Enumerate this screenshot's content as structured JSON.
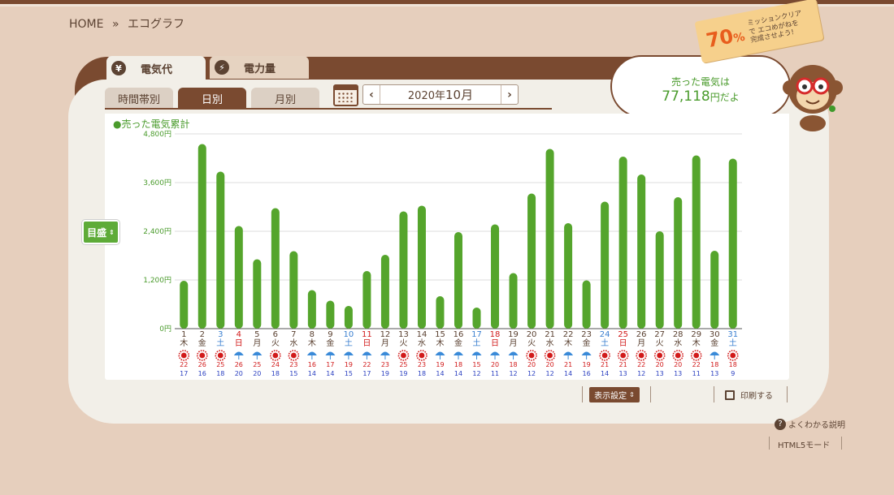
{
  "breadcrumb": {
    "home": "HOME",
    "separator": "»",
    "current": "エコグラフ"
  },
  "tag": {
    "percent": "70",
    "percent_unit": "%",
    "message": "ミッションクリアで エコめがねを 完成させよう!"
  },
  "main_tabs": [
    {
      "icon": "¥",
      "label": "電気代"
    },
    {
      "icon": "⚡",
      "label": "電力量"
    }
  ],
  "sub_tabs": [
    "時間帯別",
    "日別",
    "月別"
  ],
  "date_nav": {
    "year_prefix": "2020年",
    "month": "10月",
    "prev": "‹",
    "next": "›"
  },
  "bubble": {
    "line1": "売った電気は",
    "amount": "77,118",
    "unit": "円だよ"
  },
  "ruler_label": "目盛",
  "controls": {
    "display_settings": "表示設定",
    "print": "印刷する",
    "help": "よくわかる説明",
    "html5": "HTML5モード"
  },
  "colors": {
    "bar": "#55a52c",
    "sunday": "#d11a1a",
    "saturday": "#3a7fd0",
    "weekday": "#5a4030",
    "high": "#d11a1a",
    "low": "#2a3fc0"
  },
  "chart_data": {
    "type": "bar",
    "title": "●売った電気累計",
    "xlabel": "",
    "ylabel": "",
    "ylim": [
      0,
      4800
    ],
    "y_ticks": [
      "0円",
      "1,200円",
      "2,400円",
      "3,600円",
      "4,800円"
    ],
    "grid": true,
    "categories": [
      "1",
      "2",
      "3",
      "4",
      "5",
      "6",
      "7",
      "8",
      "9",
      "10",
      "11",
      "12",
      "13",
      "14",
      "15",
      "16",
      "17",
      "18",
      "19",
      "20",
      "21",
      "22",
      "23",
      "24",
      "25",
      "26",
      "27",
      "28",
      "29",
      "30",
      "31"
    ],
    "values": [
      1180,
      4550,
      3870,
      2530,
      1710,
      2970,
      1910,
      950,
      690,
      560,
      1420,
      1820,
      2890,
      3030,
      800,
      2380,
      520,
      2570,
      1370,
      3330,
      4430,
      2600,
      1190,
      3130,
      4240,
      3800,
      2400,
      3240,
      4270,
      1920,
      4190
    ],
    "weekdays": [
      "木",
      "金",
      "土",
      "日",
      "月",
      "火",
      "水",
      "木",
      "金",
      "土",
      "日",
      "月",
      "火",
      "水",
      "木",
      "金",
      "土",
      "日",
      "月",
      "火",
      "水",
      "木",
      "金",
      "土",
      "日",
      "月",
      "火",
      "水",
      "木",
      "金",
      "土"
    ],
    "weather": [
      "sun",
      "sun",
      "sun",
      "rain",
      "rain",
      "sun",
      "sun",
      "rain",
      "rain",
      "rain",
      "rain",
      "rain",
      "sun",
      "sun",
      "rain",
      "rain",
      "rain",
      "rain",
      "rain",
      "sun",
      "sun",
      "rain",
      "rain",
      "sun",
      "sun",
      "sun",
      "sun",
      "sun",
      "sun",
      "rain",
      "sun"
    ],
    "high_temps": [
      "22",
      "26",
      "25",
      "26",
      "25",
      "24",
      "23",
      "16",
      "17",
      "19",
      "22",
      "23",
      "25",
      "23",
      "19",
      "18",
      "15",
      "20",
      "18",
      "20",
      "20",
      "21",
      "19",
      "21",
      "21",
      "22",
      "20",
      "20",
      "22",
      "18",
      "18"
    ],
    "low_temps": [
      "17",
      "16",
      "18",
      "20",
      "20",
      "18",
      "15",
      "14",
      "14",
      "15",
      "17",
      "19",
      "19",
      "18",
      "14",
      "14",
      "12",
      "11",
      "12",
      "12",
      "12",
      "14",
      "16",
      "14",
      "13",
      "12",
      "13",
      "13",
      "11",
      "13",
      "9"
    ],
    "temp_unit": "℃"
  }
}
